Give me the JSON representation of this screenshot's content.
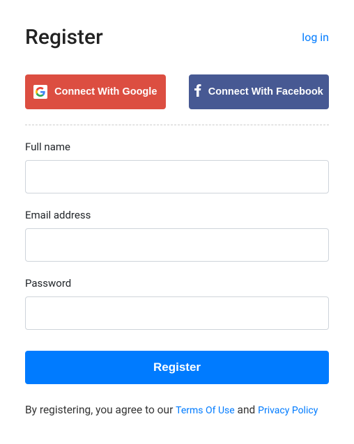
{
  "header": {
    "title": "Register",
    "login_link": "log in"
  },
  "social": {
    "google_label": "Connect With Google",
    "facebook_label": "Connect With Facebook"
  },
  "form": {
    "fullname_label": "Full name",
    "email_label": "Email address",
    "password_label": "Password",
    "submit_label": "Register"
  },
  "agree": {
    "prefix": "By registering, you agree to our ",
    "terms_label": "Terms Of Use",
    "middle": " and ",
    "privacy_label": "Privacy Policy"
  }
}
